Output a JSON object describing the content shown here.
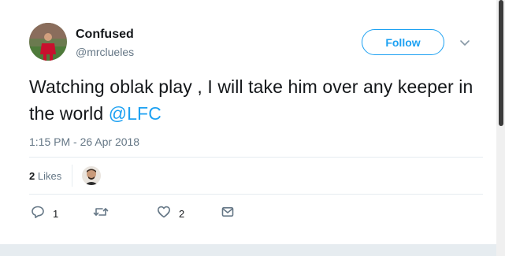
{
  "user": {
    "display_name": "Confused",
    "handle": "@mrclueles",
    "avatar_icon": "profile-photo-football-player"
  },
  "follow_button": {
    "label": "Follow"
  },
  "tweet": {
    "text": "Watching oblak play , I will take him over any keeper in the world ",
    "mention": "@LFC",
    "timestamp": "1:15 PM - 26 Apr 2018"
  },
  "stats": {
    "likes_count": "2",
    "likes_label": " Likes"
  },
  "actions": {
    "reply_count": "1",
    "retweet_count": "",
    "like_count": "2"
  },
  "colors": {
    "accent": "#1da1f2",
    "secondary_text": "#657786",
    "primary_text": "#14171a"
  }
}
